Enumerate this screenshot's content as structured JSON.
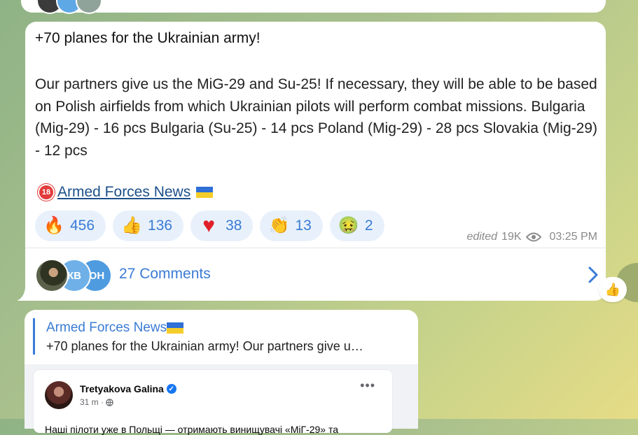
{
  "post": {
    "title": "+70 planes for the Ukrainian army!",
    "body": "Our partners give us the MiG-29 and Su-25! If necessary, they will be able to be based on Polish airfields from which Ukrainian pilots will perform combat missions. Bulgaria (Mig-29) - 16 pcs Bulgaria (Su-25) - 14 pcs Poland (Mig-29) - 28 pcs Slovakia (Mig-29) - 12 pcs",
    "signature_badge": "18",
    "signature_link": "Armed Forces News",
    "flag_colors": [
      "#2f6fd6",
      "#f5cd2a"
    ]
  },
  "reactions": [
    {
      "icon": "fire-icon",
      "emoji": "🔥",
      "count": "456"
    },
    {
      "icon": "thumbs-up-icon",
      "emoji": "👍",
      "count": "136"
    },
    {
      "icon": "heart-icon",
      "emoji": "♥",
      "count": "38"
    },
    {
      "icon": "clapping-icon",
      "emoji": "👏",
      "count": "13"
    },
    {
      "icon": "nauseated-icon",
      "emoji": "🤢",
      "count": "2"
    }
  ],
  "meta": {
    "edited": "edited",
    "views": "19K",
    "time": "03:25 PM"
  },
  "comments": {
    "avatars": [
      {
        "initials": "",
        "color": "#4a4f3a"
      },
      {
        "initials": "КВ",
        "color": "#6fb0e8"
      },
      {
        "initials": "ЮН",
        "color": "#4f9be0"
      }
    ],
    "label": "27 Comments"
  },
  "floating_reaction": {
    "icon": "thumbs-up-icon",
    "emoji": "👍"
  },
  "forwarded": {
    "source": "Armed Forces News",
    "preview": "+70 planes for the Ukrainian army! Our partners give u…",
    "fb_author": "Tretyakova Galina",
    "fb_time": "31 m ·",
    "fb_dots": "•••",
    "fb_text": "Наші пілоти уже в Польщі — отримають винищувачі «МіГ-29» та"
  },
  "colors": {
    "accent": "#3a7bd5",
    "reaction_bg": "#e8f1fb",
    "link": "#1b4f8a"
  }
}
